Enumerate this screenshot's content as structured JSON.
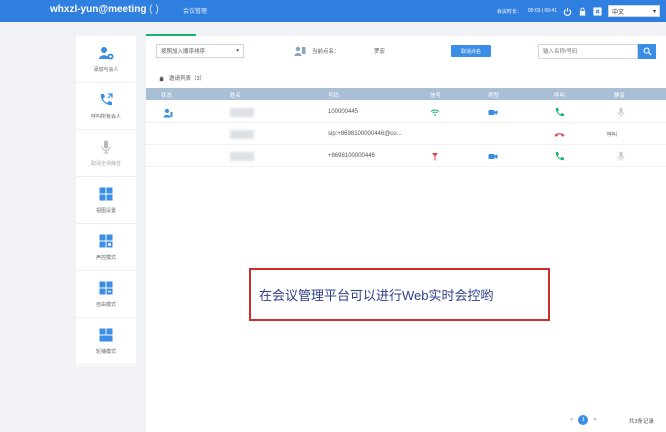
{
  "header": {
    "brand": "whxzl-yun@meeting",
    "brand_paren": "(   )",
    "tab": "会议管理",
    "session_label": "会议时长：",
    "time": "00:03 | 00:41",
    "language": "中文"
  },
  "sidebar": {
    "items": [
      {
        "label": "添加与会人",
        "icon": "add-user-icon"
      },
      {
        "label": "呼叫所有会人",
        "icon": "call-all-icon"
      },
      {
        "label": "取消全场静音",
        "icon": "mic-icon"
      },
      {
        "label": "视图设置",
        "icon": "layout-icon"
      },
      {
        "label": "声控模式",
        "icon": "voice-mode-icon"
      },
      {
        "label": "自由模式",
        "icon": "free-mode-icon"
      },
      {
        "label": "轮播模式",
        "icon": "carousel-mode-icon"
      }
    ]
  },
  "toolbar": {
    "sort_value": "按照加入顺序排序",
    "speaker_label": "当前点名：",
    "speaker_name": "罗宏",
    "cancel_label": "取消点名",
    "search_placeholder": "输入名称/号码"
  },
  "invited": {
    "label": "邀请列表（3）"
  },
  "table": {
    "columns": [
      "状态",
      "姓名",
      "号码",
      "信号",
      "类型",
      "呼叫",
      "静音"
    ],
    "rows": [
      {
        "number": "100000445",
        "call_status": "connected",
        "mute": "unmuted",
        "signal": "wifi",
        "type": "video"
      },
      {
        "number": "sip:+8698100000446@co...",
        "call_status": "hangup",
        "mute_text": "呼叫"
      },
      {
        "number": "+8698100000446",
        "call_status": "connected",
        "mute": "unmuted",
        "signal": "antenna",
        "type": "video"
      }
    ]
  },
  "annotation": {
    "text": "在会议管理平台可以进行Web实时会控哟"
  },
  "pagination": {
    "page": "1",
    "total": "共3条记录"
  },
  "colors": {
    "header": "#2f7fe0",
    "accent": "#3a8ee6",
    "green": "#19b36b",
    "red": "#e04b4b",
    "annotation_border": "#cf2c2c"
  }
}
